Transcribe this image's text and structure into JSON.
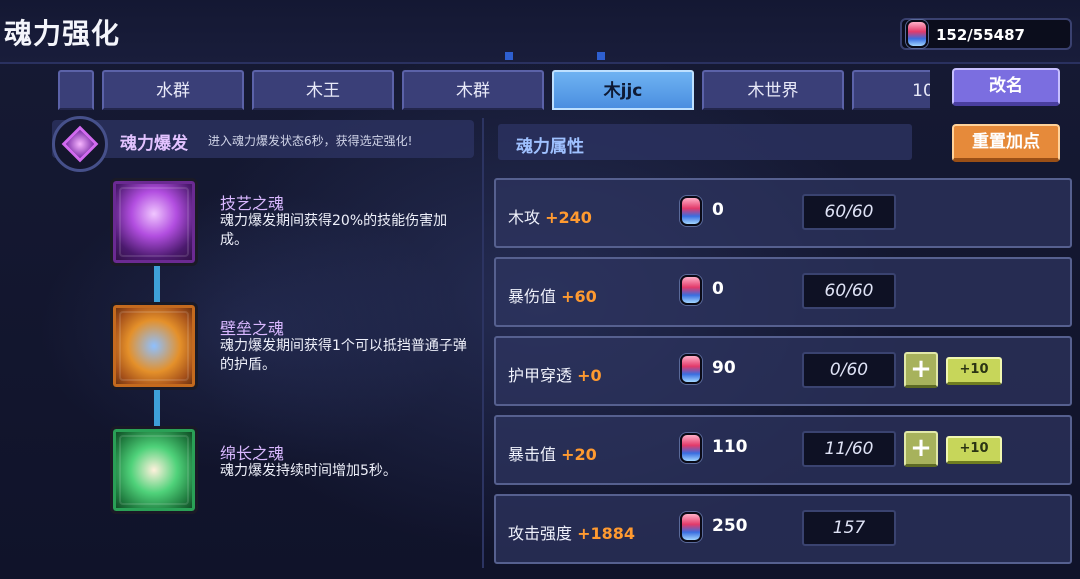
{
  "header": {
    "title": "魂力强化",
    "currency": "152/55487"
  },
  "tabs": [
    {
      "label": ""
    },
    {
      "label": "水群"
    },
    {
      "label": "木王"
    },
    {
      "label": "木群"
    },
    {
      "label": "木jjc"
    },
    {
      "label": "木世界"
    },
    {
      "label": "10"
    }
  ],
  "active_tab": "木jjc",
  "buttons": {
    "rename": "改名",
    "reset": "重置加点"
  },
  "burst": {
    "name": "魂力爆发",
    "desc": "进入魂力爆发状态6秒，获得选定强化!"
  },
  "souls": [
    {
      "name": "技艺之魂",
      "desc": "魂力爆发期间获得20%的技能伤害加成。",
      "icon": "soul-purple-flame-icon"
    },
    {
      "name": "壁垒之魂",
      "desc": "魂力爆发期间获得1个可以抵挡普通子弹的护盾。",
      "icon": "soul-shield-icon"
    },
    {
      "name": "绵长之魂",
      "desc": "魂力爆发持续时间增加5秒。",
      "icon": "soul-clock-icon"
    }
  ],
  "attributes": {
    "title": "魂力属性",
    "rows": [
      {
        "label": "木攻",
        "bonus": "+240",
        "cost": "0",
        "level": "60/60"
      },
      {
        "label": "暴伤值",
        "bonus": "+60",
        "cost": "0",
        "level": "60/60"
      },
      {
        "label": "护甲穿透",
        "bonus": "+0",
        "cost": "90",
        "level": "0/60",
        "plus": "+",
        "plus10": "+10"
      },
      {
        "label": "暴击值",
        "bonus": "+20",
        "cost": "110",
        "level": "11/60",
        "plus": "+",
        "plus10": "+10"
      },
      {
        "label": "攻击强度",
        "bonus": "+1884",
        "cost": "250",
        "level": "157"
      }
    ]
  },
  "colors": {
    "bonus": "#ff9a30",
    "active_tab": "#4b8ee0",
    "reset_button": "#e68a3a",
    "rename_button": "#7b6ee0",
    "plus_button": "#c7d65a"
  }
}
